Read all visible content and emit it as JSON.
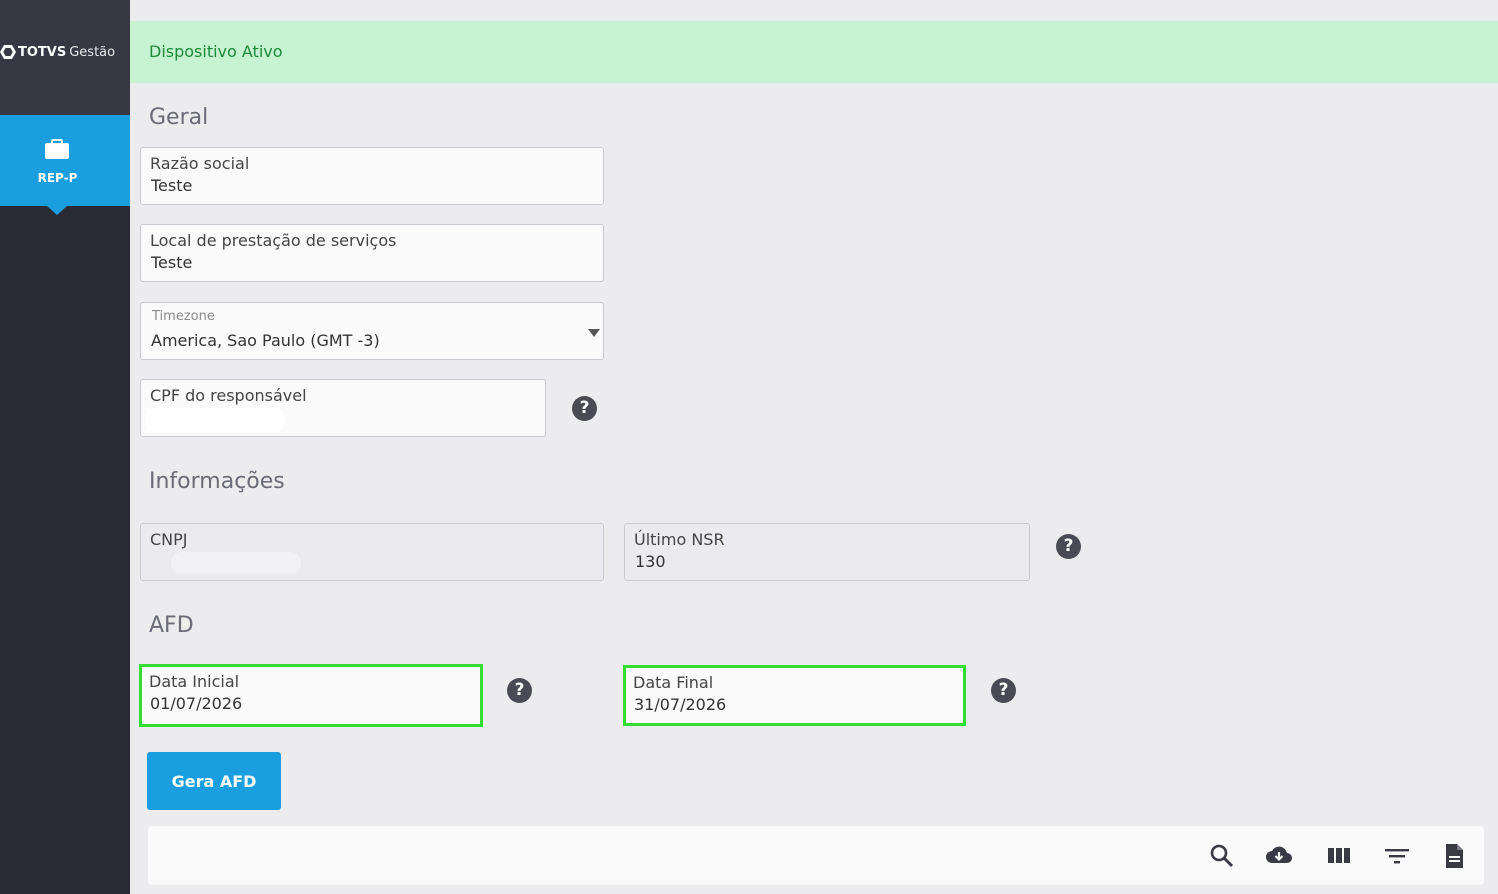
{
  "sidebar": {
    "brand": "TOTVS",
    "product": "Gestão",
    "nav_item_label": "REP-P",
    "nav_item_icon": "briefcase-icon",
    "accent_color": "#1b9ee0"
  },
  "banner": {
    "text": "Dispositivo Ativo",
    "background": "#c6f3d2"
  },
  "geral": {
    "title": "Geral",
    "razao_social": {
      "label": "Razão social",
      "value": "Teste"
    },
    "local_prestacao": {
      "label": "Local de prestação de serviços",
      "value": "Teste"
    },
    "timezone": {
      "label": "Timezone",
      "value": "America, Sao Paulo (GMT -3)"
    },
    "cpf_responsavel": {
      "label": "CPF do responsável",
      "value": ""
    }
  },
  "informacoes": {
    "title": "Informações",
    "cnpj": {
      "label": "CNPJ",
      "value": ""
    },
    "ultimo_nsr": {
      "label": "Último NSR",
      "value": "130"
    }
  },
  "afd": {
    "title": "AFD",
    "data_inicial": {
      "label": "Data Inicial",
      "value": "01/07/2026"
    },
    "data_final": {
      "label": "Data Final",
      "value": "31/07/2026"
    },
    "gera_button": "Gera AFD"
  },
  "help_glyph": "?",
  "toolbar": {
    "icons": [
      "search-icon",
      "cloud-download-icon",
      "columns-icon",
      "filter-icon",
      "document-icon"
    ]
  }
}
